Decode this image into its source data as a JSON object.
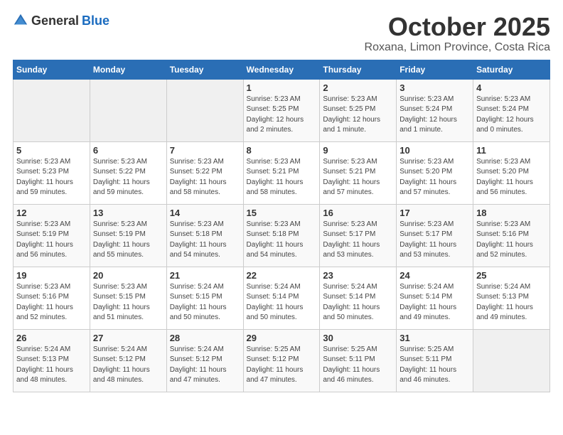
{
  "logo": {
    "general": "General",
    "blue": "Blue"
  },
  "header": {
    "month": "October 2025",
    "location": "Roxana, Limon Province, Costa Rica"
  },
  "weekdays": [
    "Sunday",
    "Monday",
    "Tuesday",
    "Wednesday",
    "Thursday",
    "Friday",
    "Saturday"
  ],
  "weeks": [
    [
      {
        "day": "",
        "info": ""
      },
      {
        "day": "",
        "info": ""
      },
      {
        "day": "",
        "info": ""
      },
      {
        "day": "1",
        "info": "Sunrise: 5:23 AM\nSunset: 5:25 PM\nDaylight: 12 hours\nand 2 minutes."
      },
      {
        "day": "2",
        "info": "Sunrise: 5:23 AM\nSunset: 5:25 PM\nDaylight: 12 hours\nand 1 minute."
      },
      {
        "day": "3",
        "info": "Sunrise: 5:23 AM\nSunset: 5:24 PM\nDaylight: 12 hours\nand 1 minute."
      },
      {
        "day": "4",
        "info": "Sunrise: 5:23 AM\nSunset: 5:24 PM\nDaylight: 12 hours\nand 0 minutes."
      }
    ],
    [
      {
        "day": "5",
        "info": "Sunrise: 5:23 AM\nSunset: 5:23 PM\nDaylight: 11 hours\nand 59 minutes."
      },
      {
        "day": "6",
        "info": "Sunrise: 5:23 AM\nSunset: 5:22 PM\nDaylight: 11 hours\nand 59 minutes."
      },
      {
        "day": "7",
        "info": "Sunrise: 5:23 AM\nSunset: 5:22 PM\nDaylight: 11 hours\nand 58 minutes."
      },
      {
        "day": "8",
        "info": "Sunrise: 5:23 AM\nSunset: 5:21 PM\nDaylight: 11 hours\nand 58 minutes."
      },
      {
        "day": "9",
        "info": "Sunrise: 5:23 AM\nSunset: 5:21 PM\nDaylight: 11 hours\nand 57 minutes."
      },
      {
        "day": "10",
        "info": "Sunrise: 5:23 AM\nSunset: 5:20 PM\nDaylight: 11 hours\nand 57 minutes."
      },
      {
        "day": "11",
        "info": "Sunrise: 5:23 AM\nSunset: 5:20 PM\nDaylight: 11 hours\nand 56 minutes."
      }
    ],
    [
      {
        "day": "12",
        "info": "Sunrise: 5:23 AM\nSunset: 5:19 PM\nDaylight: 11 hours\nand 56 minutes."
      },
      {
        "day": "13",
        "info": "Sunrise: 5:23 AM\nSunset: 5:19 PM\nDaylight: 11 hours\nand 55 minutes."
      },
      {
        "day": "14",
        "info": "Sunrise: 5:23 AM\nSunset: 5:18 PM\nDaylight: 11 hours\nand 54 minutes."
      },
      {
        "day": "15",
        "info": "Sunrise: 5:23 AM\nSunset: 5:18 PM\nDaylight: 11 hours\nand 54 minutes."
      },
      {
        "day": "16",
        "info": "Sunrise: 5:23 AM\nSunset: 5:17 PM\nDaylight: 11 hours\nand 53 minutes."
      },
      {
        "day": "17",
        "info": "Sunrise: 5:23 AM\nSunset: 5:17 PM\nDaylight: 11 hours\nand 53 minutes."
      },
      {
        "day": "18",
        "info": "Sunrise: 5:23 AM\nSunset: 5:16 PM\nDaylight: 11 hours\nand 52 minutes."
      }
    ],
    [
      {
        "day": "19",
        "info": "Sunrise: 5:23 AM\nSunset: 5:16 PM\nDaylight: 11 hours\nand 52 minutes."
      },
      {
        "day": "20",
        "info": "Sunrise: 5:23 AM\nSunset: 5:15 PM\nDaylight: 11 hours\nand 51 minutes."
      },
      {
        "day": "21",
        "info": "Sunrise: 5:24 AM\nSunset: 5:15 PM\nDaylight: 11 hours\nand 50 minutes."
      },
      {
        "day": "22",
        "info": "Sunrise: 5:24 AM\nSunset: 5:14 PM\nDaylight: 11 hours\nand 50 minutes."
      },
      {
        "day": "23",
        "info": "Sunrise: 5:24 AM\nSunset: 5:14 PM\nDaylight: 11 hours\nand 50 minutes."
      },
      {
        "day": "24",
        "info": "Sunrise: 5:24 AM\nSunset: 5:14 PM\nDaylight: 11 hours\nand 49 minutes."
      },
      {
        "day": "25",
        "info": "Sunrise: 5:24 AM\nSunset: 5:13 PM\nDaylight: 11 hours\nand 49 minutes."
      }
    ],
    [
      {
        "day": "26",
        "info": "Sunrise: 5:24 AM\nSunset: 5:13 PM\nDaylight: 11 hours\nand 48 minutes."
      },
      {
        "day": "27",
        "info": "Sunrise: 5:24 AM\nSunset: 5:12 PM\nDaylight: 11 hours\nand 48 minutes."
      },
      {
        "day": "28",
        "info": "Sunrise: 5:24 AM\nSunset: 5:12 PM\nDaylight: 11 hours\nand 47 minutes."
      },
      {
        "day": "29",
        "info": "Sunrise: 5:25 AM\nSunset: 5:12 PM\nDaylight: 11 hours\nand 47 minutes."
      },
      {
        "day": "30",
        "info": "Sunrise: 5:25 AM\nSunset: 5:11 PM\nDaylight: 11 hours\nand 46 minutes."
      },
      {
        "day": "31",
        "info": "Sunrise: 5:25 AM\nSunset: 5:11 PM\nDaylight: 11 hours\nand 46 minutes."
      },
      {
        "day": "",
        "info": ""
      }
    ]
  ]
}
